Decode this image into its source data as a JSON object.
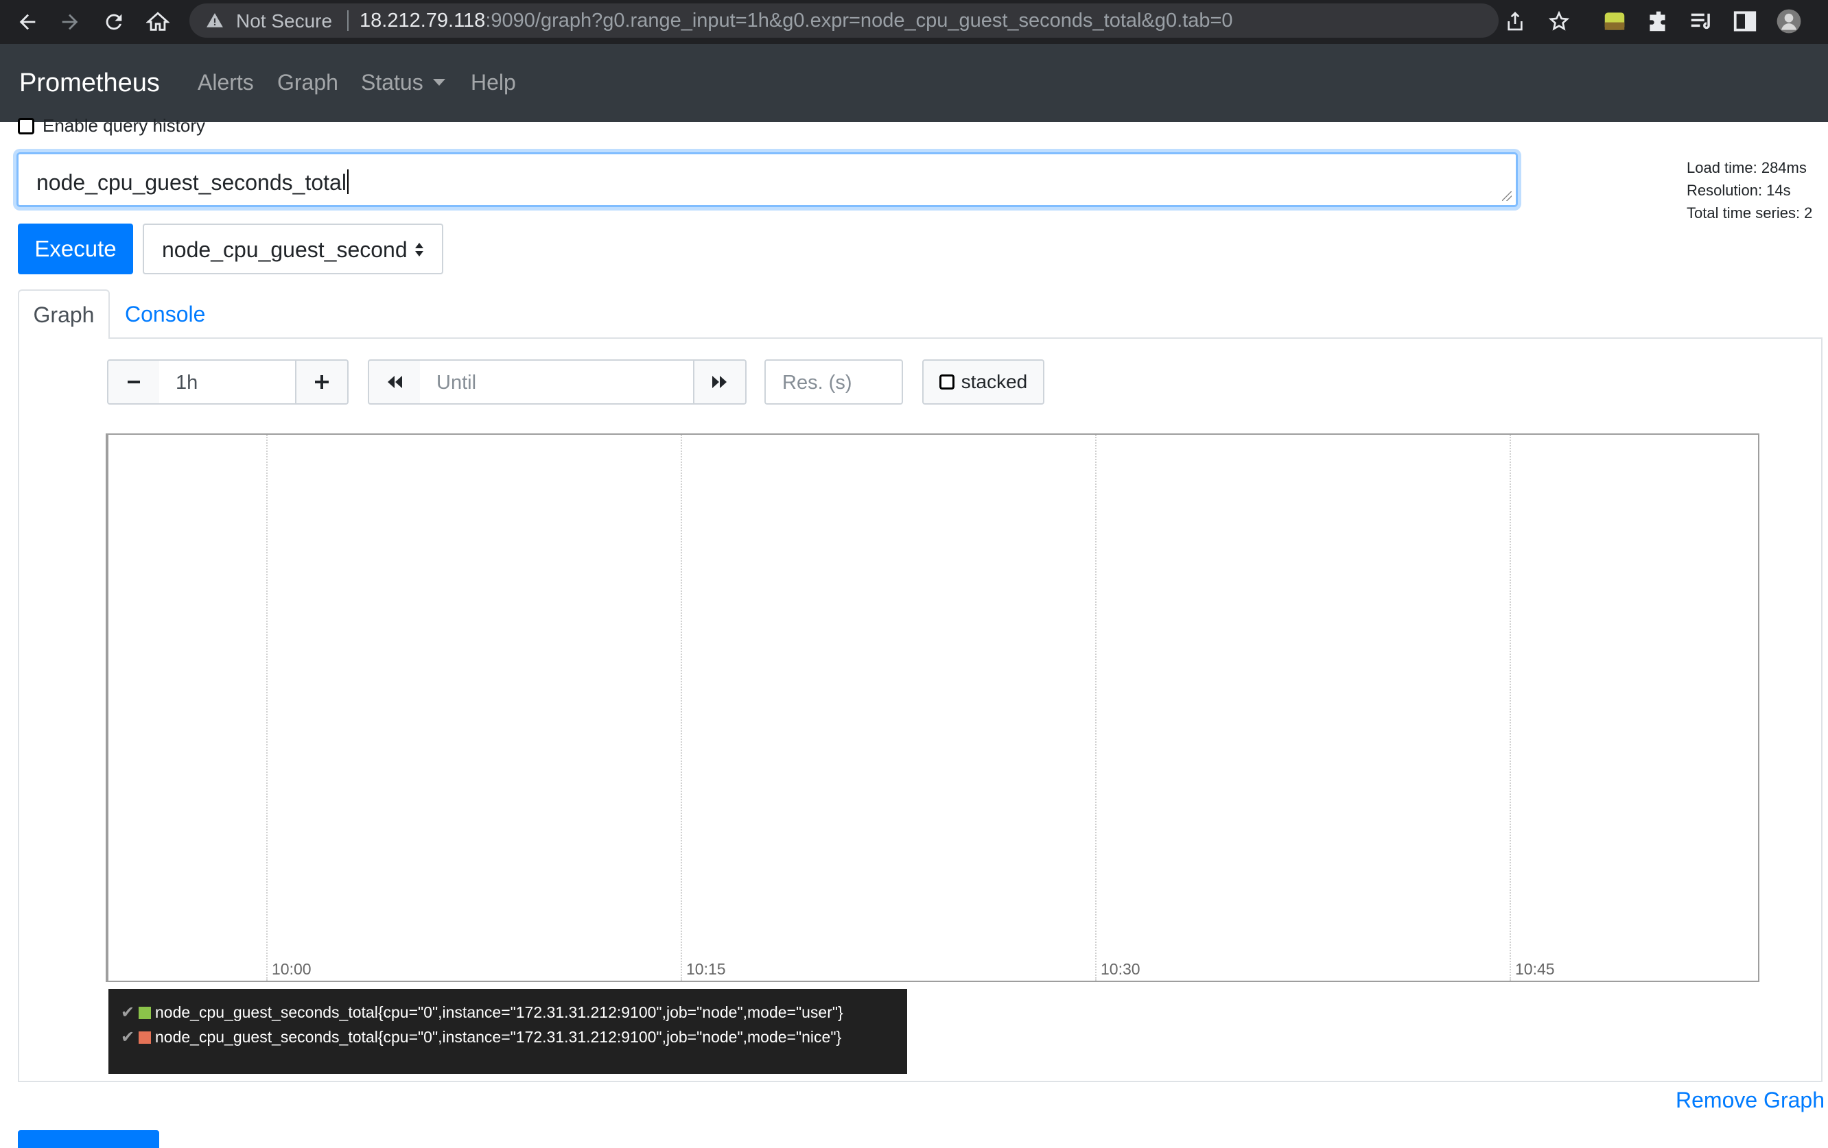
{
  "browser": {
    "security_label": "Not Secure",
    "url_host": "18.212.79.118",
    "url_rest": ":9090/graph?g0.range_input=1h&g0.expr=node_cpu_guest_seconds_total&g0.tab=0"
  },
  "navbar": {
    "brand": "Prometheus",
    "links": [
      "Alerts",
      "Graph",
      "Status",
      "Help"
    ]
  },
  "query": {
    "history_label": "Enable query history",
    "expression": "node_cpu_guest_seconds_total",
    "execute_label": "Execute",
    "metric_select_value": "node_cpu_guest_seconds_total"
  },
  "stats": {
    "load_time": "Load time: 284ms",
    "resolution": "Resolution: 14s",
    "total_series": "Total time series: 2"
  },
  "tabs": {
    "graph": "Graph",
    "console": "Console"
  },
  "controls": {
    "range_value": "1h",
    "until_placeholder": "Until",
    "resolution_placeholder": "Res. (s)",
    "stacked_label": "stacked"
  },
  "chart_data": {
    "type": "line",
    "x_ticks": [
      "10:00",
      "10:15",
      "10:30",
      "10:45"
    ],
    "series": [
      {
        "name": "node_cpu_guest_seconds_total{cpu=\"0\",instance=\"172.31.31.212:9100\",job=\"node\",mode=\"user\"}",
        "color": "#8bc34a",
        "values": []
      },
      {
        "name": "node_cpu_guest_seconds_total{cpu=\"0\",instance=\"172.31.31.212:9100\",job=\"node\",mode=\"nice\"}",
        "color": "#e57357",
        "values": []
      }
    ],
    "grid": "vertical dotted"
  },
  "footer": {
    "remove_graph": "Remove Graph"
  }
}
